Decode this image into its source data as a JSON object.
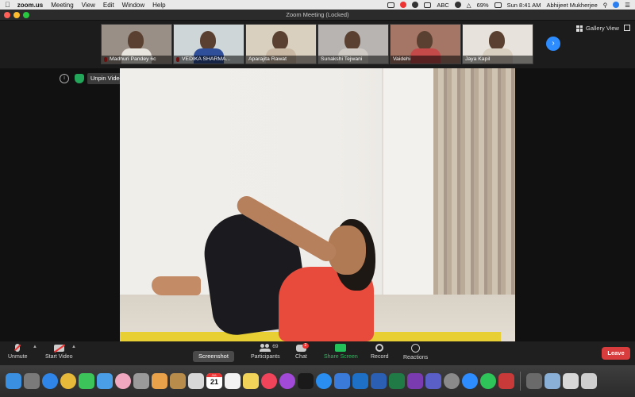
{
  "menubar": {
    "app": "zoom.us",
    "menus": [
      "Meeting",
      "View",
      "Edit",
      "Window",
      "Help"
    ],
    "keyboard": "ABC",
    "battery": "69%",
    "datetime": "Sun 8:41 AM",
    "user": "Abhijeet Mukherjee"
  },
  "window": {
    "title": "Zoom Meeting (Locked)"
  },
  "gallery": {
    "view_label": "Gallery View",
    "participants": [
      {
        "name": "Madhuri Pandey 6c",
        "bg": "#9a8f86",
        "shirt": "#e8e4de"
      },
      {
        "name": "VEDIKA SHARMA...",
        "bg": "#cfd6d8",
        "shirt": "#2f4f9a"
      },
      {
        "name": "Aparajita Rawat",
        "bg": "#d9d0c0",
        "shirt": "#c9b8a4"
      },
      {
        "name": "Sunakshi Tejwani",
        "bg": "#b8b4b2",
        "shirt": "#cfcac4"
      },
      {
        "name": "Vaidehi",
        "bg": "#a57566",
        "shirt": "#c44a4a"
      },
      {
        "name": "Jaya Kapil",
        "bg": "#e7e3dc",
        "shirt": "#d9cfc0"
      }
    ]
  },
  "video": {
    "unpin_label": "Unpin Video"
  },
  "toolbar": {
    "unmute": "Unmute",
    "start_video": "Start Video",
    "participants": "Participants",
    "participants_count": "69",
    "chat": "Chat",
    "chat_badge": "2",
    "share_screen": "Share Screen",
    "record": "Record",
    "reactions": "Reactions",
    "leave": "Leave",
    "screenshot_tooltip": "Screenshot"
  },
  "dock": {
    "calendar_day": "21",
    "calendar_month": "JUL",
    "apps": [
      {
        "name": "finder",
        "color": "#3b8fe0"
      },
      {
        "name": "launchpad",
        "color": "#7a7a7a"
      },
      {
        "name": "safari",
        "color": "#2f86e8"
      },
      {
        "name": "chrome",
        "color": "#e7b93a"
      },
      {
        "name": "facetime",
        "color": "#3cc35a"
      },
      {
        "name": "mail",
        "color": "#4a9ee8"
      },
      {
        "name": "photos",
        "color": "#f0a8c0"
      },
      {
        "name": "preview",
        "color": "#9a9a9a"
      },
      {
        "name": "photos2",
        "color": "#e9a24a"
      },
      {
        "name": "notes-brown",
        "color": "#b88c4a"
      },
      {
        "name": "screenshot",
        "color": "#d8d8d8"
      },
      {
        "name": "calendar",
        "color": "#ffffff"
      },
      {
        "name": "reminders",
        "color": "#f2f2f2"
      },
      {
        "name": "notes",
        "color": "#f2d35a"
      },
      {
        "name": "music",
        "color": "#f0445a"
      },
      {
        "name": "podcasts",
        "color": "#a24ad8"
      },
      {
        "name": "tv",
        "color": "#1a1a1a"
      },
      {
        "name": "appstore",
        "color": "#2a8ef0"
      },
      {
        "name": "xcode",
        "color": "#3a7ad8"
      },
      {
        "name": "outlook",
        "color": "#1e6fc6"
      },
      {
        "name": "word",
        "color": "#2b5fb3"
      },
      {
        "name": "excel",
        "color": "#1f7a45"
      },
      {
        "name": "onenote",
        "color": "#7b3bb0"
      },
      {
        "name": "teams",
        "color": "#5a5fc8"
      },
      {
        "name": "settings",
        "color": "#8a8a8a"
      },
      {
        "name": "zoom",
        "color": "#2d8cff"
      },
      {
        "name": "whatsapp",
        "color": "#2ec45a"
      },
      {
        "name": "photo-booth",
        "color": "#c83a3a"
      },
      {
        "name": "utility",
        "color": "#6a6a6a"
      },
      {
        "name": "downloads",
        "color": "#8ab0d8"
      },
      {
        "name": "documents",
        "color": "#d8d8d8"
      },
      {
        "name": "trash",
        "color": "#cfcfcf"
      }
    ]
  }
}
